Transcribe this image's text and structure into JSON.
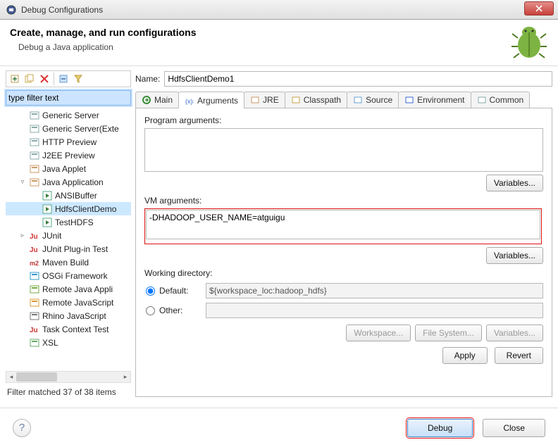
{
  "window": {
    "title": "Debug Configurations"
  },
  "header": {
    "title": "Create, manage, and run configurations",
    "subtitle": "Debug a Java application"
  },
  "left": {
    "filter_placeholder": "type filter text",
    "filter_value": "type filter text",
    "tree": [
      {
        "label": "Generic Server",
        "icon": "server",
        "depth": 1
      },
      {
        "label": "Generic Server(Exte",
        "icon": "server",
        "depth": 1
      },
      {
        "label": "HTTP Preview",
        "icon": "server",
        "depth": 1
      },
      {
        "label": "J2EE Preview",
        "icon": "server",
        "depth": 1
      },
      {
        "label": "Java Applet",
        "icon": "applet",
        "depth": 1
      },
      {
        "label": "Java Application",
        "icon": "java",
        "depth": 1,
        "expander": "▿"
      },
      {
        "label": "ANSIBuffer",
        "icon": "java-run",
        "depth": 2
      },
      {
        "label": "HdfsClientDemo",
        "icon": "java-run",
        "depth": 2,
        "selected": true
      },
      {
        "label": "TestHDFS",
        "icon": "java-run",
        "depth": 2
      },
      {
        "label": "JUnit",
        "icon": "junit",
        "depth": 1,
        "expander": "▹"
      },
      {
        "label": "JUnit Plug-in Test",
        "icon": "junit-plug",
        "depth": 1
      },
      {
        "label": "Maven Build",
        "icon": "maven",
        "depth": 1
      },
      {
        "label": "OSGi Framework",
        "icon": "osgi",
        "depth": 1
      },
      {
        "label": "Remote Java Appli",
        "icon": "remote",
        "depth": 1
      },
      {
        "label": "Remote JavaScript",
        "icon": "remote-js",
        "depth": 1
      },
      {
        "label": "Rhino JavaScript",
        "icon": "rhino",
        "depth": 1
      },
      {
        "label": "Task Context Test",
        "icon": "task",
        "depth": 1
      },
      {
        "label": "XSL",
        "icon": "xsl",
        "depth": 1
      }
    ],
    "status": "Filter matched 37 of 38 items"
  },
  "right": {
    "name_label": "Name:",
    "name_value": "HdfsClientDemo1",
    "tabs": [
      {
        "label": "Main",
        "icon": "main"
      },
      {
        "label": "Arguments",
        "icon": "args",
        "active": true
      },
      {
        "label": "JRE",
        "icon": "jre"
      },
      {
        "label": "Classpath",
        "icon": "cp"
      },
      {
        "label": "Source",
        "icon": "src"
      },
      {
        "label": "Environment",
        "icon": "env"
      },
      {
        "label": "Common",
        "icon": "common"
      }
    ],
    "prog_args_label": "Program arguments:",
    "prog_args_value": "",
    "vm_args_label": "VM arguments:",
    "vm_args_value": "-DHADOOP_USER_NAME=atguigu",
    "variables_btn": "Variables...",
    "wd_label": "Working directory:",
    "wd_default_label": "Default:",
    "wd_default_value": "${workspace_loc:hadoop_hdfs}",
    "wd_other_label": "Other:",
    "wd_other_value": "",
    "workspace_btn": "Workspace...",
    "filesystem_btn": "File System...",
    "apply_btn": "Apply",
    "revert_btn": "Revert"
  },
  "footer": {
    "debug_btn": "Debug",
    "close_btn": "Close"
  }
}
